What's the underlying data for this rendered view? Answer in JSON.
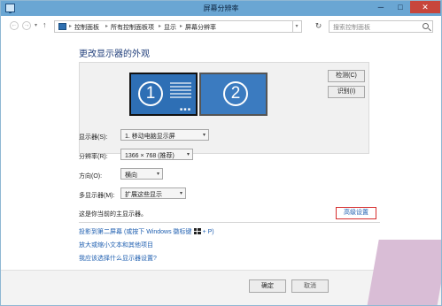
{
  "window": {
    "title": "屏幕分辨率",
    "min_glyph": "─",
    "max_glyph": "□",
    "close_glyph": "✕",
    "close_color": "#c7463c",
    "titlebar_color": "#6aa6d3"
  },
  "nav": {
    "back_glyph": "←",
    "forward_glyph": "→",
    "history_glyph": "▾",
    "up_glyph": "↑",
    "breadcrumbs": [
      "控制面板",
      "所有控制面板项",
      "显示",
      "屏幕分辨率"
    ],
    "crumb_separator": "▸",
    "dropdown_glyph": "▾",
    "refresh_glyph": "↻",
    "search_placeholder": "搜索控制面板"
  },
  "main": {
    "heading": "更改显示器的外观",
    "monitor_1_number": "1",
    "monitor_2_number": "2",
    "detect_button": "检测(C)",
    "identify_button": "识别(I)",
    "display_label": "显示器(S):",
    "display_value": "1. 移动电脑显示屏",
    "resolution_label": "分辨率(R):",
    "resolution_value": "1366 × 768 (推荐)",
    "orientation_label": "方向(O):",
    "orientation_value": "横向",
    "multi_display_label": "多显示器(M):",
    "multi_display_value": "扩展这些显示",
    "select_arrow": "▾",
    "primary_text": "这是你当前的主显示器。",
    "advanced_button": "高级设置",
    "link_project_prefix": "投影到第二屏幕 (或按下 Windows 徽标键",
    "link_project_suffix": "+ P)",
    "link_text_size": "放大或缩小文本和其他项目",
    "link_which_settings": "我应该选择什么显示器设置?",
    "accent_color": "#2e6fb5",
    "link_color": "#1f5fb0"
  },
  "footer": {
    "ok_button": "确定",
    "cancel_button": "取消"
  }
}
